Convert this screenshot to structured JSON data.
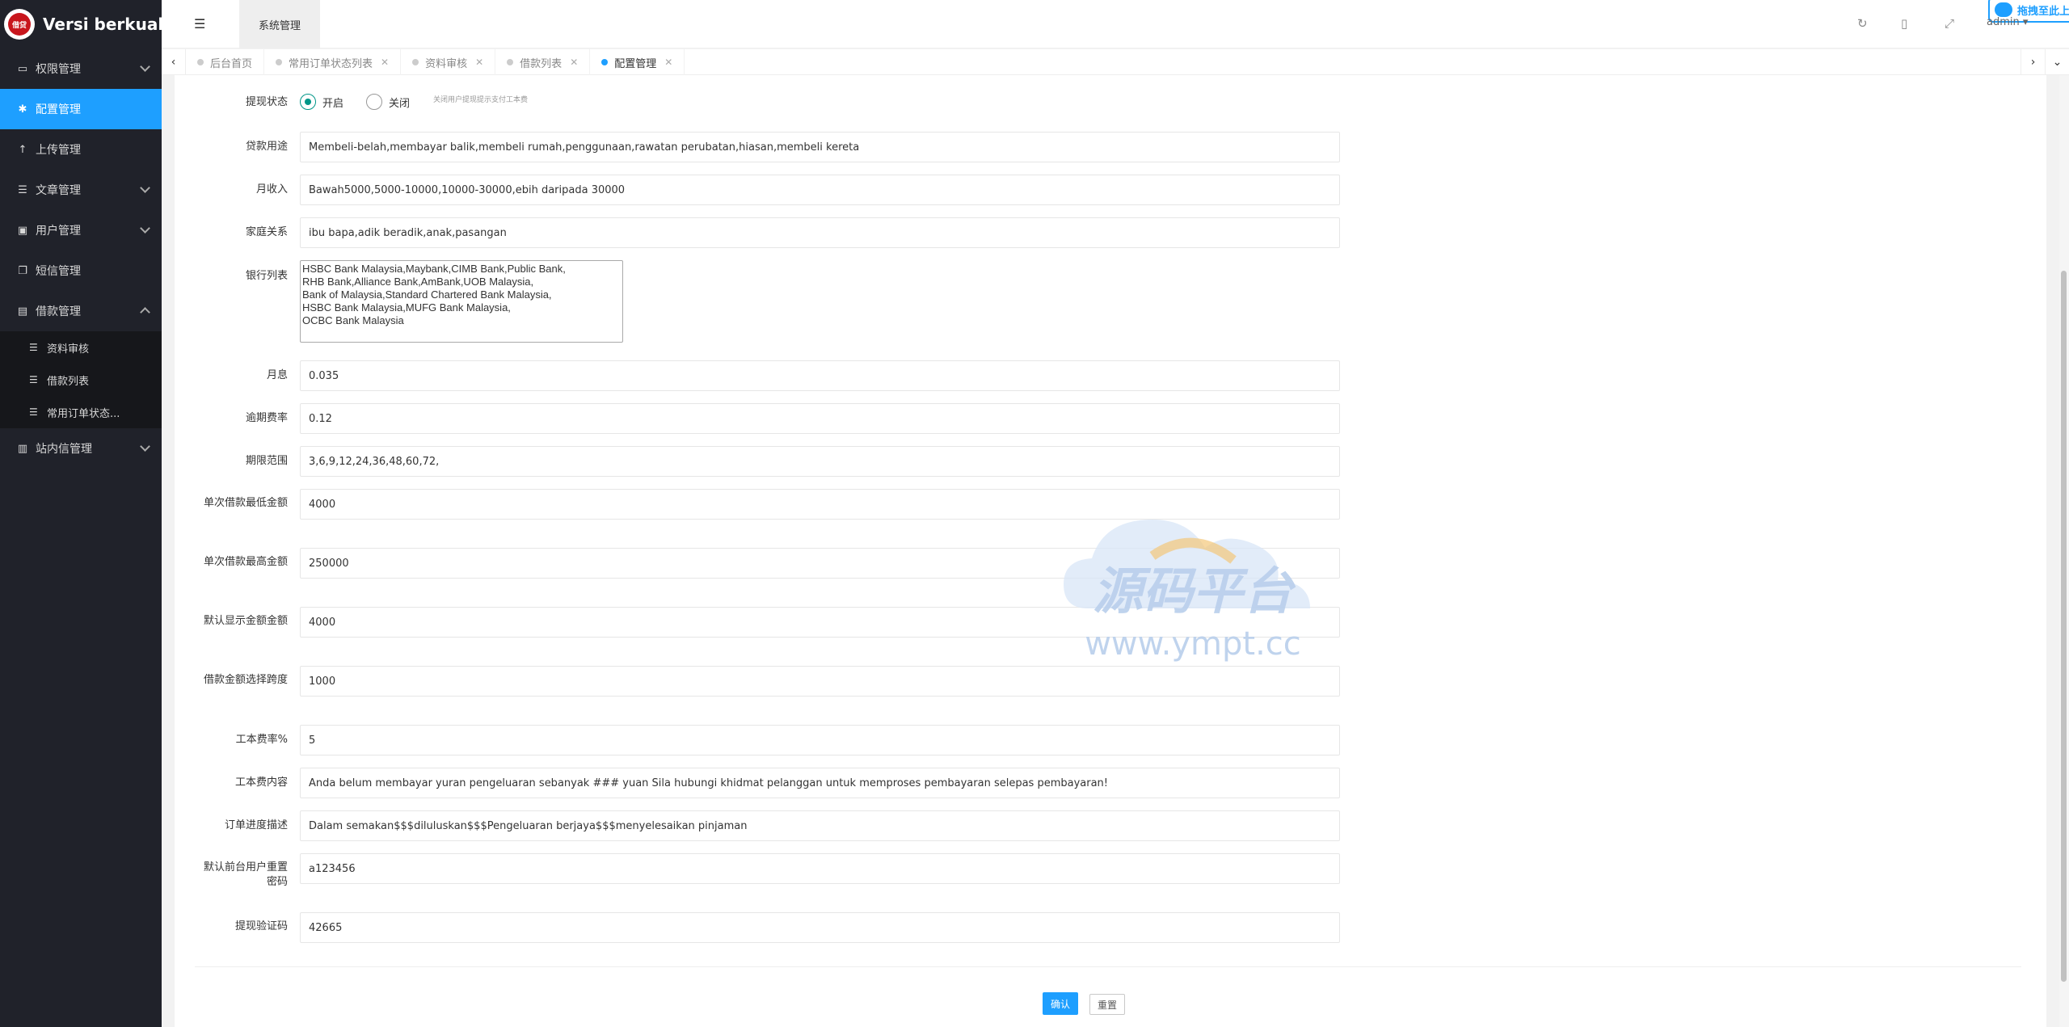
{
  "sidebar": {
    "brand_title": "Versi berkualiti",
    "logo_text": "借贷",
    "items": [
      {
        "label": "权限管理",
        "icon": "laptop-icon"
      },
      {
        "label": "配置管理",
        "icon": "gear-icon"
      },
      {
        "label": "上传管理",
        "icon": "upload-icon"
      },
      {
        "label": "文章管理",
        "icon": "list-icon"
      },
      {
        "label": "用户管理",
        "icon": "user-card-icon"
      },
      {
        "label": "短信管理",
        "icon": "copy-icon"
      },
      {
        "label": "借款管理",
        "icon": "money-icon"
      },
      {
        "label": "站内信管理",
        "icon": "chart-icon"
      }
    ],
    "sub_items": [
      {
        "label": "资料审核"
      },
      {
        "label": "借款列表"
      },
      {
        "label": "常用订单状态..."
      }
    ]
  },
  "header": {
    "tab_label": "系统管理",
    "upload_label": "拖拽至此上传",
    "user": "admin"
  },
  "tabs": [
    {
      "label": "后台首页",
      "closable": false
    },
    {
      "label": "常用订单状态列表",
      "closable": true
    },
    {
      "label": "资料审核",
      "closable": true
    },
    {
      "label": "借款列表",
      "closable": true
    },
    {
      "label": "配置管理",
      "closable": true,
      "active": true
    }
  ],
  "form": {
    "withdraw_status": {
      "label": "提现状态",
      "options": [
        "开启",
        "关闭"
      ],
      "selected": "开启",
      "hint": "关闭用户提现提示支付工本费"
    },
    "fields": [
      {
        "label": "贷款用途",
        "value": "Membeli-belah,membayar balik,membeli rumah,penggunaan,rawatan perubatan,hiasan,membeli kereta"
      },
      {
        "label": "月收入",
        "value": "Bawah5000,5000-10000,10000-30000,ebih daripada 30000"
      },
      {
        "label": "家庭关系",
        "value": "ibu bapa,adik beradik,anak,pasangan"
      },
      {
        "label": "银行列表",
        "value": "HSBC Bank Malaysia,Maybank,CIMB Bank,Public Bank,\nRHB Bank,Alliance Bank,AmBank,UOB Malaysia,\nBank of Malaysia,Standard Chartered Bank Malaysia,\nHSBC Bank Malaysia,MUFG Bank Malaysia,\nOCBC Bank Malaysia"
      },
      {
        "label": "月息",
        "value": "0.035"
      },
      {
        "label": "逾期费率",
        "value": "0.12"
      },
      {
        "label": "期限范围",
        "value": "3,6,9,12,24,36,48,60,72,"
      },
      {
        "label": "单次借款最低金额",
        "value": "4000"
      },
      {
        "label": "单次借款最高金额",
        "value": "250000"
      },
      {
        "label": "默认显示金额金额",
        "value": "4000"
      },
      {
        "label": "借款金额选择跨度",
        "value": "1000"
      },
      {
        "label": "工本费率%",
        "value": "5"
      },
      {
        "label": "工本费内容",
        "value": "Anda belum membayar yuran pengeluaran sebanyak ### yuan Sila hubungi khidmat pelanggan untuk memproses pembayaran selepas pembayaran!"
      },
      {
        "label": "订单进度描述",
        "value": "Dalam semakan$$$diluluskan$$$Pengeluaran berjaya$$$menyelesaikan pinjaman"
      },
      {
        "label": "默认前台用户重置密码",
        "value": "a123456"
      },
      {
        "label": "提现验证码",
        "value": "42665"
      }
    ],
    "submit_label": "确认",
    "reset_label": "重置"
  },
  "watermark": {
    "title": "源码平台",
    "url": "www.ympt.cc"
  }
}
